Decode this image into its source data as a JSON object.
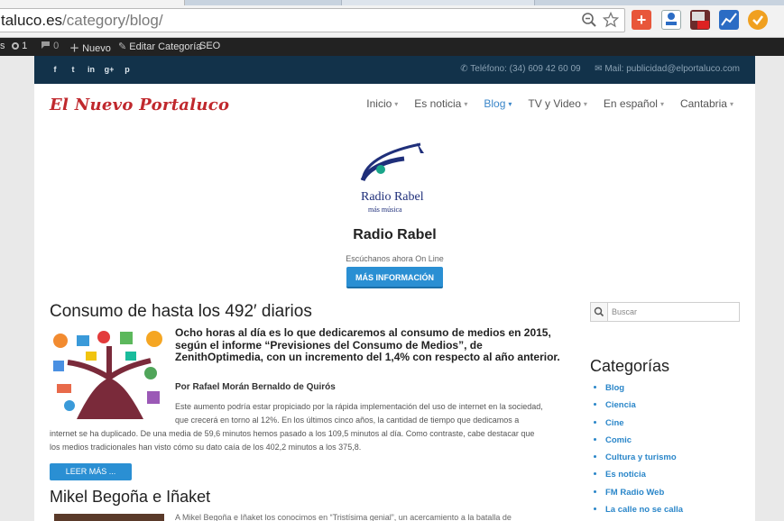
{
  "browser": {
    "url_host": "taluco.es",
    "url_path": "/category/blog/",
    "zoom_icon": "zoom-icon",
    "bookmark_icon": "star-icon",
    "extensions": [
      "plus-extension-icon",
      "accessibility-extension-icon",
      "wpva-extension-icon",
      "analytics-extension-icon",
      "orange-extension-icon"
    ],
    "ext_plus_label": "+"
  },
  "adminbar": {
    "updates_count": "1",
    "comments_count": "0",
    "new_label": "Nuevo",
    "edit_label": "Editar Categoría",
    "seo_label": "SEO",
    "left_fragment": "s"
  },
  "topbar": {
    "social": [
      "f",
      "t",
      "in",
      "g+",
      "p"
    ],
    "phone": "Teléfono: (34) 609 42 60 09",
    "mail": "Mail: publicidad@elportaluco.com",
    "bg_color": "#12324a"
  },
  "header": {
    "logo": "El Nuevo Portaluco",
    "nav": [
      {
        "label": "Inicio",
        "active": false
      },
      {
        "label": "Es noticia",
        "active": false
      },
      {
        "label": "Blog",
        "active": true
      },
      {
        "label": "TV y Video",
        "active": false
      },
      {
        "label": "En español",
        "active": false
      },
      {
        "label": "Cantabria",
        "active": false
      }
    ]
  },
  "banner": {
    "logo_text": "Radio Rabel",
    "logo_tagline": "más música",
    "title": "Radio Rabel",
    "subtitle": "Escúchanos ahora On Line",
    "button": "MÁS INFORMACIÓN"
  },
  "posts": [
    {
      "title": "Consumo de hasta los 492′ diarios",
      "lead": "Ocho horas al día es lo que dedicaremos al consumo de medios en 2015, según el informe “Previsiones del Consumo de Medios”, de ZenithOptimedia, con un incremento del 1,4% con respecto al año anterior.",
      "byline": "Por Rafael Morán Bernaldo de Quirós",
      "excerpt_1": "Este aumento podría estar propiciado por la rápida implementación del uso de internet en la sociedad,",
      "excerpt_2": "que crecerá en torno al 12%. En los últimos cinco años, la cantidad de tiempo que dedicamos a",
      "excerpt_3": "internet se ha duplicado. De una media de 59,6 minutos hemos pasado a los 109,5 minutos al día. Como contraste, cabe destacar que",
      "excerpt_4": "los medios tradicionales han visto cómo su dato caía de los 402,2 minutos a los 375,8.",
      "more": "LEER MÁS ..."
    },
    {
      "title": "Mikel Begoña e Iñaket",
      "lead_partial": "A Mikel Begoña e Iñaket los conocimos en “Tristísima genial”, un acercamiento a la batalla de"
    }
  ],
  "sidebar": {
    "search_placeholder": "Buscar",
    "categories_title": "Categorías",
    "categories": [
      "Blog",
      "Ciencia",
      "Cine",
      "Comic",
      "Cultura y turismo",
      "Es noticia",
      "FM Radio Web",
      "La calle no se calla"
    ]
  },
  "colors": {
    "accent": "#2a8fd3",
    "logo_red": "#c0282d",
    "link_blue": "#2a86c9"
  }
}
